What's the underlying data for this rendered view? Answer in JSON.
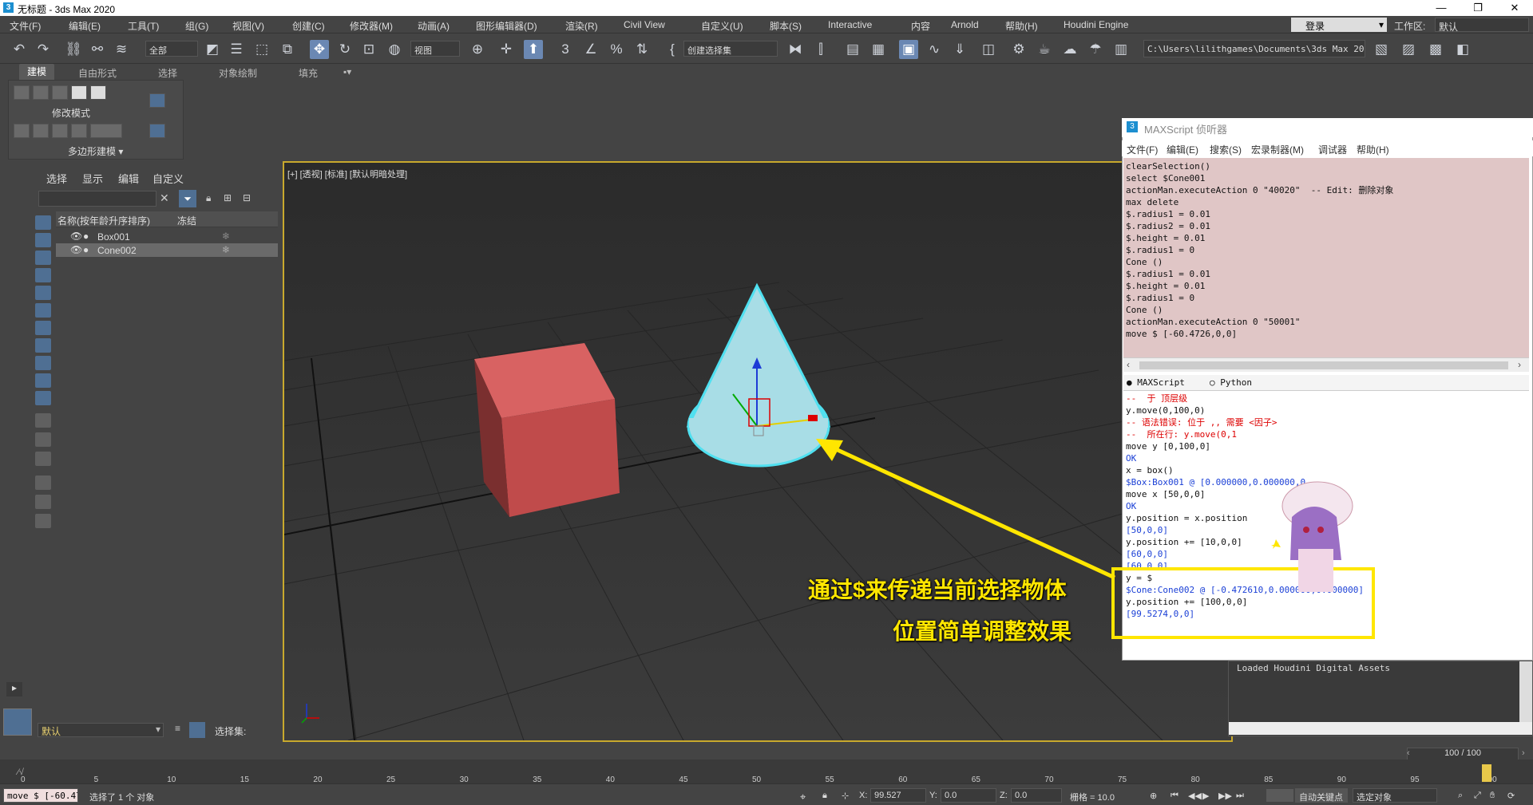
{
  "window": {
    "title": "无标题 - 3ds Max 2020",
    "controls": [
      "—",
      "❐",
      "✕"
    ]
  },
  "menu": [
    "文件(F)",
    "编辑(E)",
    "工具(T)",
    "组(G)",
    "视图(V)",
    "创建(C)",
    "修改器(M)",
    "动画(A)",
    "图形编辑器(D)",
    "渲染(R)",
    "Civil View",
    "自定义(U)",
    "脚本(S)",
    "Interactive",
    "内容",
    "Arnold",
    "帮助(H)",
    "Houdini Engine"
  ],
  "account": {
    "login": "登录",
    "workspace_label": "工作区:",
    "workspace_value": "默认"
  },
  "toolbar": {
    "filter": "全部",
    "ref_coord": "视图",
    "selection_set": "创建选择集",
    "path": "C:\\Users\\lilithgames\\Documents\\3ds Max 2020"
  },
  "ribbon": {
    "tabs": [
      "建模",
      "自由形式",
      "选择",
      "对象绘制",
      "填充"
    ],
    "modify_mode": "修改模式",
    "poly_modeling": "多边形建模"
  },
  "scene_explorer": {
    "menu": [
      "选择",
      "显示",
      "编辑",
      "自定义"
    ],
    "col_name": "名称(按年龄升序排序)",
    "col_freeze": "冻结",
    "rows": [
      {
        "name": "Box001",
        "selected": false
      },
      {
        "name": "Cone002",
        "selected": true
      }
    ],
    "layer": "默认",
    "selection_set_label": "选择集:"
  },
  "viewport": {
    "label": "[+] [透视] [标准] [默认明暗处理]"
  },
  "listener": {
    "title": "MAXScript 侦听器",
    "menu": [
      "文件(F)",
      "编辑(E)",
      "搜索(S)",
      "宏录制器(M)",
      "调试器",
      "帮助(H)"
    ],
    "macro_lines": [
      "clearSelection()",
      "select $Cone001",
      "actionMan.executeAction 0 \"40020\"  -- Edit: 删除对象",
      "max delete",
      "$.radius1 = 0.01",
      "$.radius2 = 0.01",
      "$.height = 0.01",
      "$.radius1 = 0",
      "Cone ()",
      "$.radius1 = 0.01",
      "$.height = 0.01",
      "$.radius1 = 0",
      "Cone ()",
      "actionMan.executeAction 0 \"50001\"",
      "move $ [-60.4726,0,0]"
    ],
    "tabs": [
      "MAXScript",
      "Python"
    ],
    "output_lines": [
      {
        "t": "--  于 顶层级",
        "c": "red"
      },
      {
        "t": "y.move(0,100,0)",
        "c": "blk"
      },
      {
        "t": "-- 语法错误: 位于 ,, 需要 <因子>",
        "c": "red"
      },
      {
        "t": "--  所在行: y.move(0,1",
        "c": "red"
      },
      {
        "t": "move y [0,100,0]",
        "c": "blk"
      },
      {
        "t": "OK",
        "c": "blu"
      },
      {
        "t": "x = box()",
        "c": "blk"
      },
      {
        "t": "$Box:Box001 @ [0.000000,0.000000,0",
        "c": "blu"
      },
      {
        "t": "move x [50,0,0]",
        "c": "blk"
      },
      {
        "t": "OK",
        "c": "blu"
      },
      {
        "t": "y.position = x.position",
        "c": "blk"
      },
      {
        "t": "[50,0,0]",
        "c": "blu"
      },
      {
        "t": "y.position += [10,0,0]",
        "c": "blk"
      },
      {
        "t": "[60,0,0]",
        "c": "blu"
      },
      {
        "t": "[60,0,0]",
        "c": "blu"
      },
      {
        "t": "y = $",
        "c": "blk"
      },
      {
        "t": "$Cone:Cone002 @ [-0.472610,0.000000,0.000000]",
        "c": "blu"
      },
      {
        "t": "y.position += [100,0,0]",
        "c": "blk"
      },
      {
        "t": "[99.5274,0,0]",
        "c": "blu"
      }
    ]
  },
  "houdini": {
    "text": "Loaded Houdini Digital Assets"
  },
  "annotation": {
    "line1": "通过$来传递当前选择物体",
    "line2": "位置简单调整效果"
  },
  "timeline": {
    "frame_display": "100 / 100",
    "ticks": [
      "0",
      "5",
      "10",
      "15",
      "20",
      "25",
      "30",
      "35",
      "40",
      "45",
      "50",
      "55",
      "60",
      "65",
      "70",
      "75",
      "80",
      "85",
      "90",
      "95",
      "100"
    ]
  },
  "status": {
    "mini_listener": "move $ [-60.47",
    "selection": "选择了 1 个 对象",
    "x_label": "X:",
    "x": "99.527",
    "y_label": "Y:",
    "y": "0.0",
    "z_label": "Z:",
    "z": "0.0",
    "grid": "栅格 = 10.0",
    "auto_key": "自动关键点",
    "selected_obj": "选定对象"
  },
  "colors": {
    "box": "#c85252",
    "cone": "#a8dde6",
    "cone_edge": "#4fe0f0",
    "annotation": "#ffe600",
    "viewport_border": "#c8a92d"
  }
}
